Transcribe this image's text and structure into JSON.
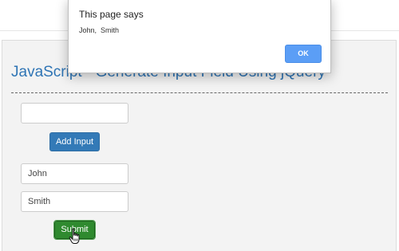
{
  "page": {
    "title": "JavaScript - Generate Input Field Using jQuery"
  },
  "form": {
    "new_input_value": "",
    "add_button_label": "Add Input",
    "generated_inputs": [
      {
        "value": "John"
      },
      {
        "value": "Smith"
      }
    ],
    "submit_button_label": "Submit"
  },
  "dialog": {
    "heading": "This page says",
    "message": "John,  Smith",
    "ok_label": "OK"
  },
  "colors": {
    "title": "#2f75b5",
    "add_button": "#337ab7",
    "submit_button": "#2f8a2f",
    "ok_button": "#5b9ef6"
  },
  "icons": {
    "cursor": "hand-pointer-cursor"
  }
}
